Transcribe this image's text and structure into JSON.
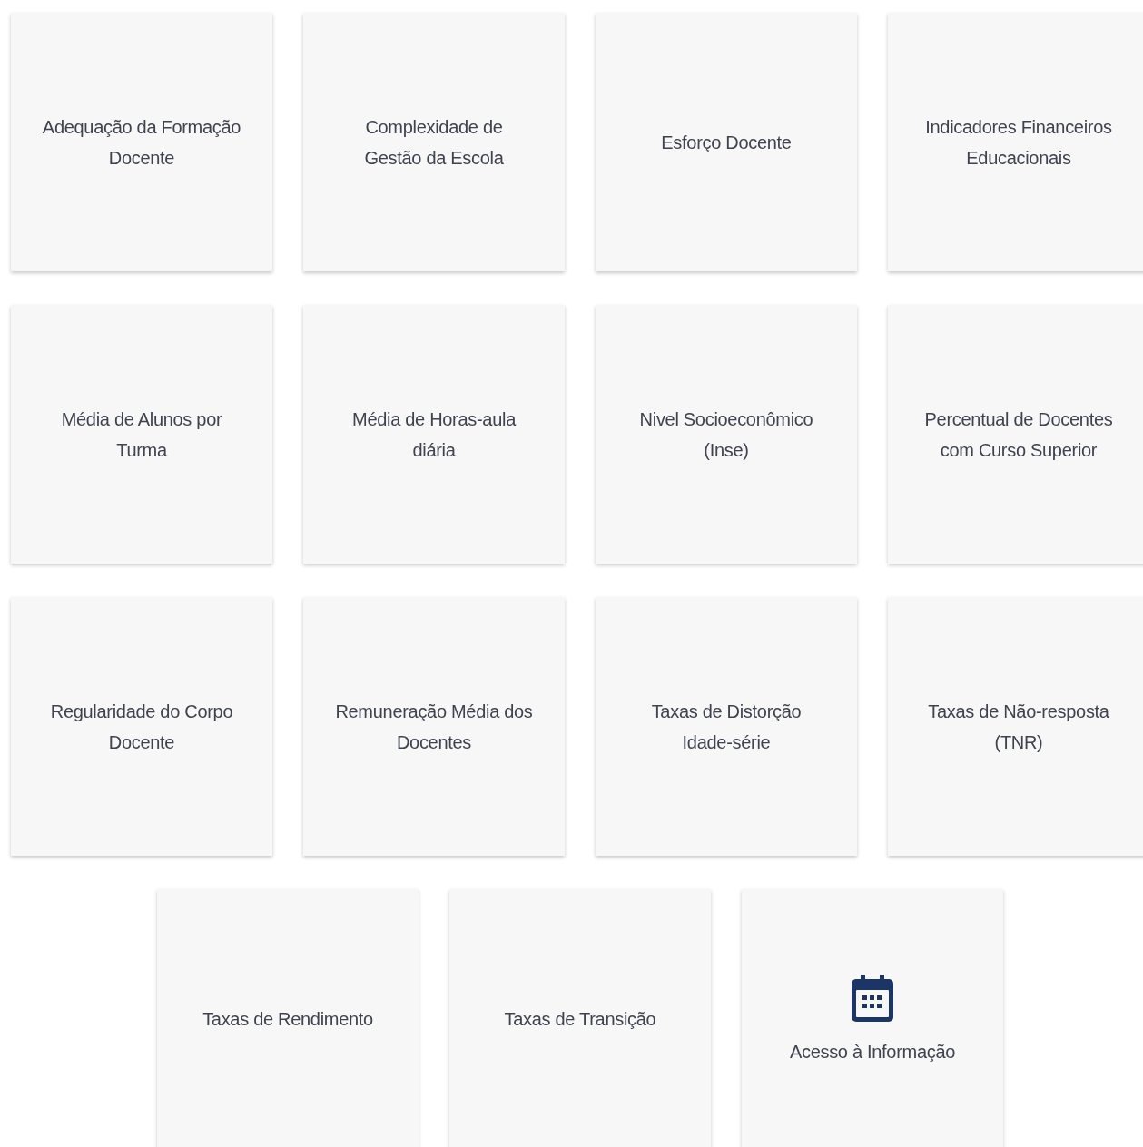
{
  "rows": [
    [
      {
        "kind": "text",
        "label": "Adequação da Formação\nDocente"
      },
      {
        "kind": "text",
        "label": "Complexidade de\nGestão da Escola"
      },
      {
        "kind": "text",
        "label": "Esforço Docente"
      },
      {
        "kind": "text",
        "label": "Indicadores Financeiros\nEducacionais"
      }
    ],
    [
      {
        "kind": "text",
        "label": "Média de Alunos por\nTurma"
      },
      {
        "kind": "text",
        "label": "Média de Horas-aula\ndiária"
      },
      {
        "kind": "text",
        "label": "Nivel Socioeconômico\n(Inse)"
      },
      {
        "kind": "text",
        "label": "Percentual de Docentes\ncom Curso Superior"
      }
    ],
    [
      {
        "kind": "text",
        "label": "Regularidade do Corpo\nDocente"
      },
      {
        "kind": "text",
        "label": "Remuneração Média dos\nDocentes"
      },
      {
        "kind": "text",
        "label": "Taxas de Distorção\nIdade-série"
      },
      {
        "kind": "text",
        "label": "Taxas de Não-resposta\n(TNR)"
      }
    ],
    [
      {
        "kind": "text",
        "label": "Taxas de Rendimento"
      },
      {
        "kind": "text",
        "label": "Taxas de Transição"
      },
      {
        "kind": "icon",
        "label": "Acesso à Informação"
      }
    ]
  ]
}
